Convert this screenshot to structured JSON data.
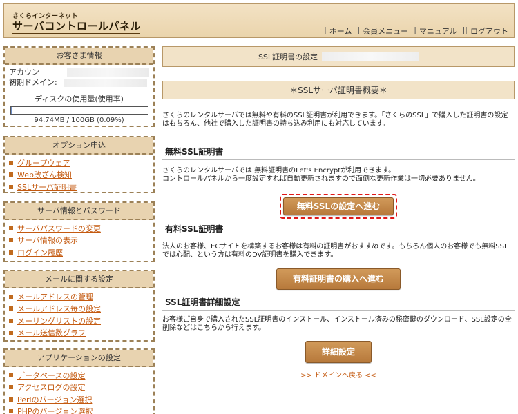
{
  "header": {
    "logo_small": "さくらインターネット",
    "logo_big": "サーバコントロールパネル",
    "nav": [
      "ホーム",
      "会員メニュー",
      "マニュアル",
      "ログアウト"
    ]
  },
  "customer_info": {
    "title": "お客さま情報",
    "account_label": "アカウント:",
    "domain_label": "初期ドメイン:",
    "disk_title": "ディスクの使用量(使用率)",
    "disk_usage_fraction": 0.0009,
    "disk_text": "94.74MB / 100GB (0.09%)"
  },
  "option_menu": {
    "title": "オプション申込",
    "items": [
      "グループウェア",
      "Web改ざん検知",
      "SSLサーバ証明書"
    ]
  },
  "server_menu": {
    "title": "サーバ情報とパスワード",
    "items": [
      "サーバパスワードの変更",
      "サーバ情報の表示",
      "ログイン履歴"
    ]
  },
  "mail_menu": {
    "title": "メールに関する設定",
    "items": [
      "メールアドレスの管理",
      "メールアドレス毎の設定",
      "メーリングリストの設定",
      "メール送信数グラフ"
    ]
  },
  "app_menu": {
    "title": "アプリケーションの設定",
    "items": [
      "データベースの設定",
      "アクセスログの設定",
      "Perlのバージョン選択",
      "PHPのバージョン選択"
    ]
  },
  "main": {
    "page_title": "SSL証明書の設定",
    "overview_title": "＊SSLサーバ証明書概要＊",
    "overview_text": "さくらのレンタルサーバでは無料や有料のSSL証明書が利用できます。「さくらのSSL」で購入した証明書の設定はもちろん、他社で購入した証明書の持ち込み利用にも対応しています。",
    "free_heading": "無料SSL証明書",
    "free_text_1": "さくらのレンタルサーバでは 無料証明書のLet's Encryptが利用できます。",
    "free_text_2": "コントロールパネルから一度設定すれば自動更新されますので面倒な更新作業は一切必要ありません。",
    "free_button": "無料SSLの設定へ進む",
    "paid_heading": "有料SSL証明書",
    "paid_text": "法人のお客様、ECサイトを構築するお客様は有料の証明書がおすすめです。もちろん個人のお客様でも無料SSLでは心配、という方は有料のDV証明書を購入できます。",
    "paid_button": "有料証明書の購入へ進む",
    "detail_heading": "SSL証明書詳細設定",
    "detail_text": "お客様ご自身で購入されたSSL証明書のインストール、インストール済みの秘密鍵のダウンロード、SSL設定の全削除などはこちらから行えます。",
    "detail_button": "詳細設定",
    "back_link": ">> ドメインへ戻る <<"
  }
}
